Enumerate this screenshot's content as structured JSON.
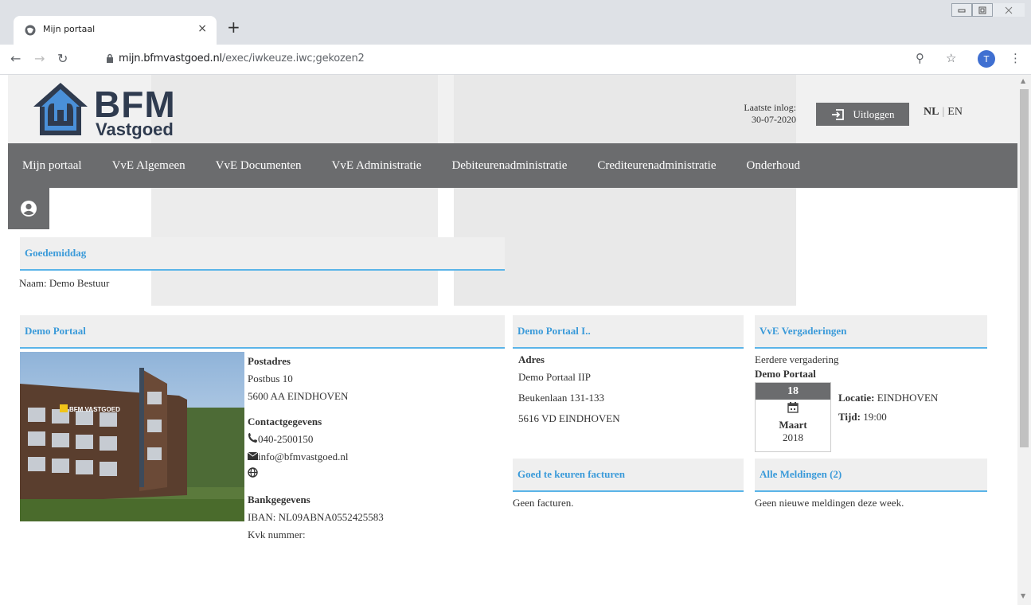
{
  "browser": {
    "tab_title": "Mijn portaal",
    "tab_close": "×",
    "new_tab": "+",
    "url_host": "mijn.bfmvastgoed.nl",
    "url_path": "/exec/iwkeuze.iwc;gekozen2",
    "profile_initial": "T"
  },
  "header": {
    "logo_bfm": "BFM",
    "logo_vastgoed": "Vastgoed",
    "last_login_label": "Laatste inlog:",
    "last_login_date": "30-07-2020",
    "logout_label": "Uitloggen",
    "lang_nl": "NL",
    "lang_en": "EN"
  },
  "nav": {
    "items": [
      "Mijn portaal",
      "VvE Algemeen",
      "VvE Documenten",
      "VvE Administratie",
      "Debiteurenadministratie",
      "Crediteurenadministratie",
      "Onderhoud"
    ]
  },
  "greeting": {
    "title": "Goedemiddag",
    "name_line": "Naam: Demo Bestuur"
  },
  "portal": {
    "title": "Demo Portaal",
    "postal_heading": "Postadres",
    "postal_line1": "Postbus 10",
    "postal_line2": "5600 AA EINDHOVEN",
    "contact_heading": "Contactgegevens",
    "phone": "040-2500150",
    "email": "info@bfmvastgoed.nl",
    "bank_heading": "Bankgegevens",
    "iban": "IBAN: NL09ABNA0552425583",
    "kvk": "Kvk nummer:"
  },
  "portal2": {
    "title": "Demo Portaal I..",
    "address_heading": "Adres",
    "line1": "Demo Portaal IIP",
    "line2": "Beukenlaan 131-133",
    "line3": "5616 VD EINDHOVEN"
  },
  "meetings": {
    "title": "VvE Vergaderingen",
    "previous_label": "Eerdere vergadering",
    "meeting_name": "Demo Portaal",
    "day": "18",
    "month": "Maart",
    "year": "2018",
    "location_label": "Locatie:",
    "location_value": "EINDHOVEN",
    "time_label": "Tijd:",
    "time_value": "19:00"
  },
  "invoices": {
    "title": "Goed te keuren facturen",
    "empty": "Geen facturen."
  },
  "notifications": {
    "title": "Alle Meldingen (2)",
    "empty": "Geen nieuwe meldingen deze week."
  },
  "colors": {
    "nav_bg": "#6b6c6e",
    "accent_blue": "#3a9ad9",
    "logo_navy": "#2f3b4f"
  }
}
